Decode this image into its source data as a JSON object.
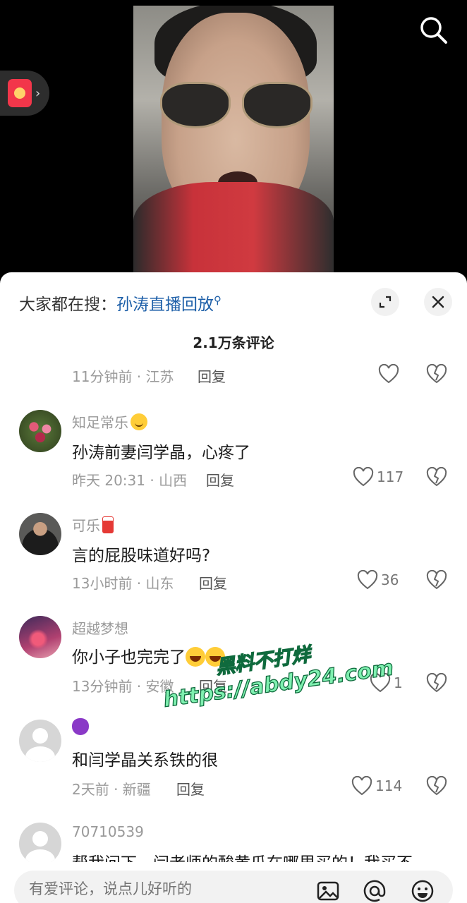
{
  "video": {
    "search_icon": "search-icon",
    "red_packet_icon": "red-packet-icon"
  },
  "panel": {
    "trending_prefix": "大家都在搜：",
    "trending_keyword": "孙涛直播回放",
    "comment_count": "2.1万条评论"
  },
  "comments": [
    {
      "time_loc": "11分钟前 · 江苏",
      "reply": "回复"
    },
    {
      "username": "知足常乐",
      "emoji": "smile",
      "text": "孙涛前妻闫学晶，心疼了",
      "time_loc": "昨天 20:31 · 山西",
      "reply": "回复",
      "likes": "117"
    },
    {
      "username": "可乐",
      "emoji": "cup",
      "text": "言的屁股味道好吗?",
      "time_loc": "13小时前 · 山东",
      "reply": "回复",
      "likes": "36"
    },
    {
      "username": "超越梦想",
      "text": "你小子也完完了",
      "time_loc": "13分钟前 · 安徽",
      "reply": "回复",
      "likes": "1"
    },
    {
      "username": "",
      "emoji": "devil",
      "text": "和闫学晶关系铁的很",
      "time_loc": "2天前 · 新疆",
      "reply": "回复",
      "likes": "114"
    },
    {
      "username": "70710539",
      "text": "帮我问下，闫老师的酸黄瓜在哪里买的！我买不"
    }
  ],
  "watermark": {
    "line1": "黑料不打烊",
    "line2": "https://abdy24.com"
  },
  "input": {
    "placeholder": "有爱评论，说点儿好听的"
  },
  "colors": {
    "keyword": "#1d5fa8",
    "watermark": "#7ff0b0"
  }
}
